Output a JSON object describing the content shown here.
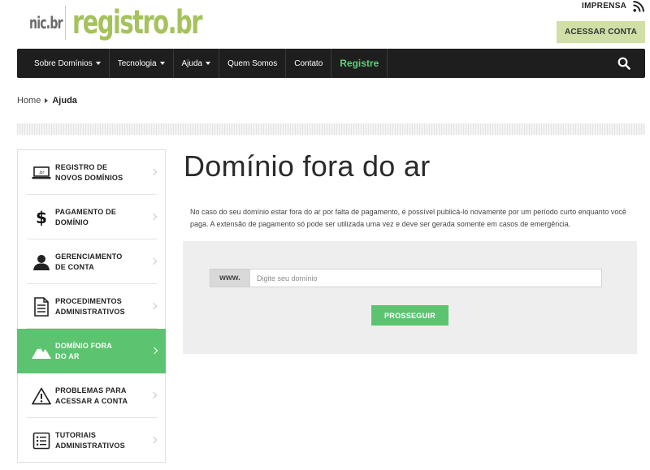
{
  "header": {
    "logo_nic": "nic.br",
    "logo_registro": "registro.br",
    "imprensa_label": "IMPRENSA",
    "acessar_label": "ACESSAR CONTA",
    "rss_icon": "rss-icon"
  },
  "nav": {
    "items": [
      {
        "label": "Sobre Domínios",
        "dropdown": true
      },
      {
        "label": "Tecnologia",
        "dropdown": true
      },
      {
        "label": "Ajuda",
        "dropdown": true
      },
      {
        "label": "Quem Somos",
        "dropdown": false
      },
      {
        "label": "Contato",
        "dropdown": false
      },
      {
        "label": "Registre",
        "dropdown": false
      }
    ],
    "search_icon": "search-icon"
  },
  "breadcrumb": {
    "home": "Home",
    "current": "Ajuda"
  },
  "sidebar": {
    "items": [
      {
        "line1": "REGISTRO DE",
        "line2": "NOVOS DOMÍNIOS",
        "icon": "laptop-icon",
        "active": false
      },
      {
        "line1": "PAGAMENTO DE",
        "line2": "DOMÍNIO",
        "icon": "dollar-icon",
        "active": false
      },
      {
        "line1": "GERENCIAMENTO",
        "line2": "DE CONTA",
        "icon": "user-icon",
        "active": false
      },
      {
        "line1": "PROCEDIMENTOS",
        "line2": "ADMINISTRATIVOS",
        "icon": "document-icon",
        "active": false
      },
      {
        "line1": "DOMÍNIO FORA",
        "line2": "DO AR",
        "icon": "landscape-icon",
        "active": true
      },
      {
        "line1": "PROBLEMAS PARA",
        "line2": "ACESSAR A CONTA",
        "icon": "warning-icon",
        "active": false
      },
      {
        "line1": "TUTORIAIS",
        "line2": "ADMINISTRATIVOS",
        "icon": "list-icon",
        "active": false
      }
    ]
  },
  "main": {
    "title": "Domínio fora do ar",
    "description": "No caso do seu domínio estar fora do ar por falta de pagamento, é possível publicá-lo novamente por um período curto enquanto você paga. A extensão de pagamento só pode ser utilizada uma vez e deve ser gerada somente em casos de emergência.",
    "form": {
      "prefix": "www.",
      "placeholder": "Digite seu domínio",
      "value": "",
      "submit_label": "PROSSEGUIR"
    }
  },
  "colors": {
    "accent_green": "#5cc470",
    "logo_green": "#a5c25c",
    "nav_bg": "#1e1e1e",
    "acessar_bg": "#cfdfa6"
  }
}
